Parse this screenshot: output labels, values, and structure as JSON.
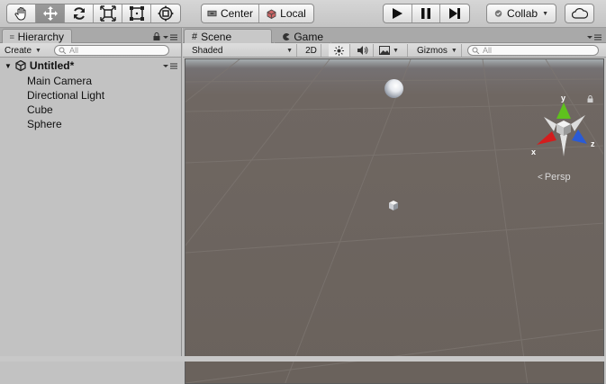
{
  "toolbar": {
    "transform_tools": [
      "hand-tool-icon",
      "move-tool-icon",
      "rotate-tool-icon",
      "scale-tool-icon",
      "rect-tool-icon",
      "transform-tool-icon"
    ],
    "active_tool_index": 1,
    "pivot_center": "Center",
    "pivot_local": "Local",
    "play_buttons": [
      "play-icon",
      "pause-icon",
      "step-icon"
    ],
    "collab_label": "Collab"
  },
  "hierarchy": {
    "tab_label": "Hierarchy",
    "create_label": "Create",
    "search_placeholder": "All",
    "scene_name": "Untitled*",
    "items": [
      "Main Camera",
      "Directional Light",
      "Cube",
      "Sphere"
    ]
  },
  "scene_panel": {
    "tabs": [
      "Scene",
      "Game"
    ],
    "shading_mode": "Shaded",
    "toggle_2d": "2D",
    "gizmos_label": "Gizmos",
    "search_placeholder": "All",
    "persp_label": "Persp",
    "axis_labels": {
      "x": "x",
      "y": "y",
      "z": "z"
    },
    "colors": {
      "axis_x": "#d31d1d",
      "axis_y": "#5fc11d",
      "axis_z": "#2a5bd6"
    }
  }
}
